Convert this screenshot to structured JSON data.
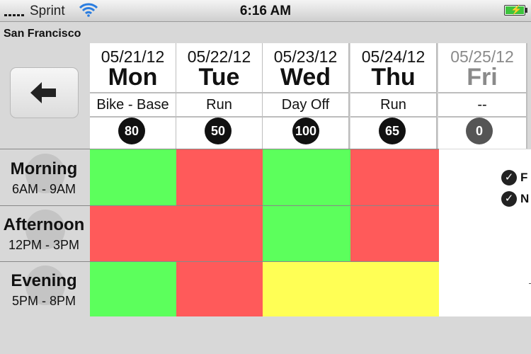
{
  "status_bar": {
    "carrier": "Sprint",
    "time": "6:16 AM"
  },
  "location": "San Francisco",
  "days": [
    {
      "date": "05/21/12",
      "name": "Mon",
      "activity": "Bike - Base",
      "score": "80"
    },
    {
      "date": "05/22/12",
      "name": "Tue",
      "activity": "Run",
      "score": "50"
    },
    {
      "date": "05/23/12",
      "name": "Wed",
      "activity": "Day Off",
      "score": "100"
    },
    {
      "date": "05/24/12",
      "name": "Thu",
      "activity": "Run",
      "score": "65"
    },
    {
      "date": "05/25/12",
      "name": "Fri",
      "activity": "--",
      "score": "0"
    }
  ],
  "slots": [
    {
      "name": "Morning",
      "time": "6AM - 9AM"
    },
    {
      "name": "Afternoon",
      "time": "12PM - 3PM"
    },
    {
      "name": "Evening",
      "time": "5PM - 8PM"
    }
  ],
  "grid": [
    [
      "good",
      "bad",
      "good",
      "bad"
    ],
    [
      "bad",
      "bad",
      "good",
      "bad"
    ],
    [
      "good",
      "bad",
      "fair",
      "fair"
    ]
  ],
  "legend_items": [
    "F",
    "N"
  ],
  "colors": {
    "good": "#5cff5c",
    "bad": "#ff5a5a",
    "fair": "#ffff55"
  }
}
